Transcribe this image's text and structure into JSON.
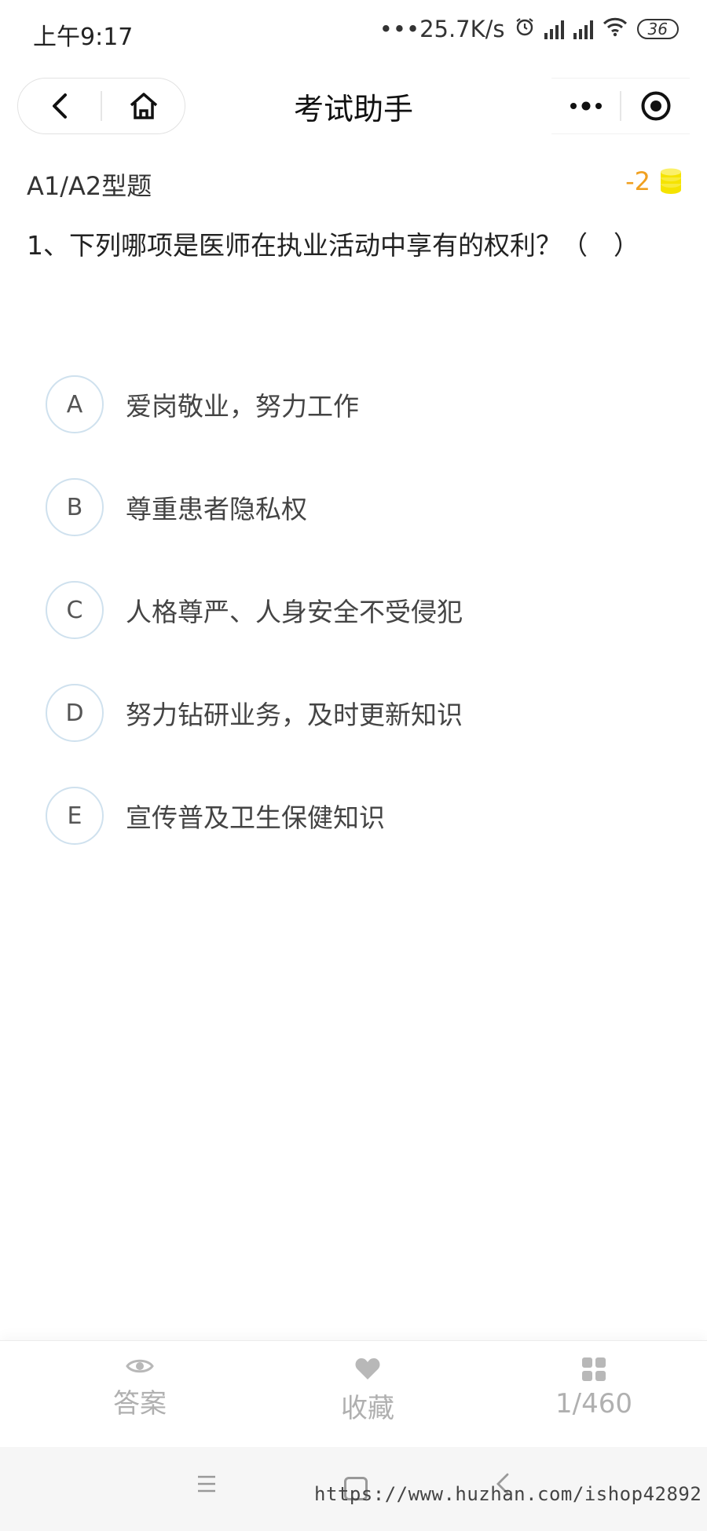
{
  "status_bar": {
    "time": "上午9:17",
    "network_speed": "•••25.7K/s",
    "battery": "36"
  },
  "nav": {
    "title": "考试助手",
    "icons": [
      "back-icon",
      "home-icon",
      "more-icon",
      "record-icon"
    ]
  },
  "question": {
    "type": "A1/A2型题",
    "score": "-2",
    "text": "1、下列哪项是医师在执业活动中享有的权利？（　）"
  },
  "options": [
    {
      "letter": "A",
      "text": "爱岗敬业，努力工作"
    },
    {
      "letter": "B",
      "text": "尊重患者隐私权"
    },
    {
      "letter": "C",
      "text": "人格尊严、人身安全不受侵犯"
    },
    {
      "letter": "D",
      "text": "努力钻研业务，及时更新知识"
    },
    {
      "letter": "E",
      "text": "宣传普及卫生保健知识"
    }
  ],
  "bottom_bar": {
    "answer_label": "答案",
    "favorite_label": "收藏",
    "page": "1/460"
  },
  "watermark": "https://www.huzhan.com/ishop42892",
  "colors": {
    "score": "#f0a020",
    "coin": "#f5e300",
    "option_border": "#cfe1ee",
    "bottom_label": "#b0b0b0"
  }
}
